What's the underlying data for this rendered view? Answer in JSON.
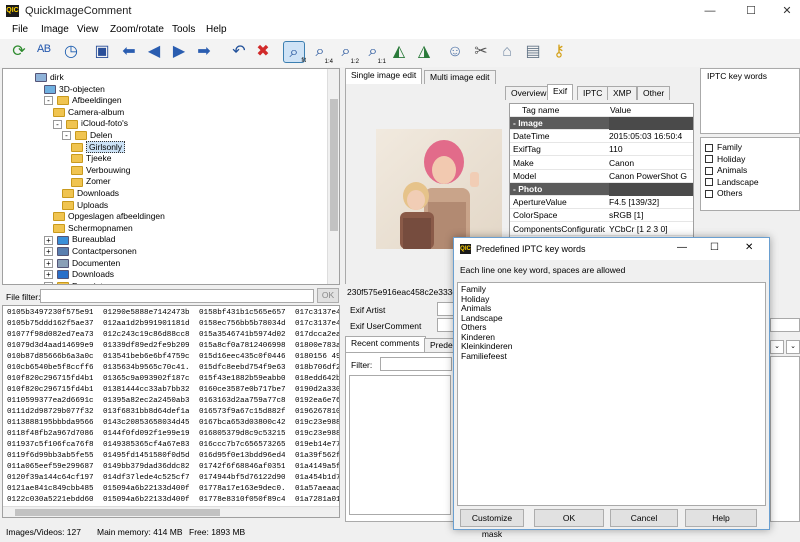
{
  "window": {
    "title": "QuickImageComment",
    "app_icon": "QIC",
    "minimize": "—",
    "maximize": "☐",
    "close": "✕"
  },
  "menu": [
    "File",
    "Image",
    "View",
    "Zoom/rotate",
    "Tools",
    "Help"
  ],
  "toolbar": [
    {
      "icon": "refresh-icon",
      "glyph": "⟳",
      "color": "#2e8b2e"
    },
    {
      "icon": "spellcheck-icon",
      "glyph": "ᴬᴮ",
      "color": "#2a5db0"
    },
    {
      "icon": "clock-icon",
      "glyph": "◷",
      "color": "#1f5fb0"
    },
    {
      "icon": "save-icon",
      "glyph": "▣",
      "color": "#2a4f99"
    },
    {
      "icon": "arrow-left-icon",
      "glyph": "⬅",
      "color": "#2a5db0"
    },
    {
      "icon": "circle-left-icon",
      "glyph": "◀",
      "color": "#2a5db0"
    },
    {
      "icon": "circle-right-icon",
      "glyph": "▶",
      "color": "#2a5db0"
    },
    {
      "icon": "arrow-right-icon",
      "glyph": "➡",
      "color": "#2a5db0"
    },
    {
      "icon": "undo-icon",
      "glyph": "↶",
      "color": "#1f4f99"
    },
    {
      "icon": "delete-icon",
      "glyph": "✖",
      "color": "#d12a2a"
    },
    {
      "icon": "zoom-fit-icon",
      "glyph": "⌕",
      "color": "#1f4f99",
      "sub": "fit",
      "selected": true
    },
    {
      "icon": "zoom-1-4-icon",
      "glyph": "⌕",
      "color": "#1f4f99",
      "sub": "1:4"
    },
    {
      "icon": "zoom-1-2-icon",
      "glyph": "⌕",
      "color": "#1f4f99",
      "sub": "1:2"
    },
    {
      "icon": "zoom-1-1-icon",
      "glyph": "⌕",
      "color": "#1f4f99",
      "sub": "1:1"
    },
    {
      "icon": "rotate-left-icon",
      "glyph": "◭",
      "color": "#2a7a3a"
    },
    {
      "icon": "rotate-right-icon",
      "glyph": "◮",
      "color": "#2a7a3a"
    },
    {
      "icon": "users-icon",
      "glyph": "☺",
      "color": "#4a6fa5"
    },
    {
      "icon": "tools-icon",
      "glyph": "✂",
      "color": "#555555"
    },
    {
      "icon": "tag-icon",
      "glyph": "⌂",
      "color": "#7a8fa8"
    },
    {
      "icon": "document-icon",
      "glyph": "▤",
      "color": "#667788"
    },
    {
      "icon": "key-icon",
      "glyph": "⚷",
      "color": "#d4a017"
    }
  ],
  "tree": [
    {
      "indent": 2,
      "exp": "",
      "kind": "user",
      "label": "dirk"
    },
    {
      "indent": 3,
      "exp": "",
      "kind": "cube",
      "label": "3D-objecten"
    },
    {
      "indent": 3,
      "exp": "-",
      "kind": "folder",
      "label": "Afbeeldingen"
    },
    {
      "indent": 4,
      "exp": "",
      "kind": "folder",
      "label": "Camera-album"
    },
    {
      "indent": 4,
      "exp": "-",
      "kind": "folder",
      "label": "iCloud-foto's"
    },
    {
      "indent": 5,
      "exp": "-",
      "kind": "folder",
      "label": "Delen"
    },
    {
      "indent": 6,
      "exp": "",
      "kind": "folder",
      "label": "Girlsonly",
      "selected": true
    },
    {
      "indent": 6,
      "exp": "",
      "kind": "folder",
      "label": "Tjeeke"
    },
    {
      "indent": 6,
      "exp": "",
      "kind": "folder",
      "label": "Verbouwing"
    },
    {
      "indent": 6,
      "exp": "",
      "kind": "folder",
      "label": "Zomer"
    },
    {
      "indent": 5,
      "exp": "",
      "kind": "folder",
      "label": "Downloads"
    },
    {
      "indent": 5,
      "exp": "",
      "kind": "folder",
      "label": "Uploads"
    },
    {
      "indent": 4,
      "exp": "",
      "kind": "folder",
      "label": "Opgeslagen afbeeldingen"
    },
    {
      "indent": 4,
      "exp": "",
      "kind": "folder",
      "label": "Schermopnamen"
    },
    {
      "indent": 3,
      "exp": "+",
      "kind": "desktop",
      "label": "Bureaublad"
    },
    {
      "indent": 3,
      "exp": "+",
      "kind": "contacts",
      "label": "Contactpersonen"
    },
    {
      "indent": 3,
      "exp": "+",
      "kind": "docs",
      "label": "Documenten"
    },
    {
      "indent": 3,
      "exp": "+",
      "kind": "download",
      "label": "Downloads"
    },
    {
      "indent": 3,
      "exp": "+",
      "kind": "folder",
      "label": "Favorieten"
    }
  ],
  "file_filter": {
    "label": "File filter:",
    "value": "",
    "ok": "OK"
  },
  "files": [
    [
      "0105b3497230f575e916...",
      "01290e5888e7142473b...",
      "0158bf431b1c565e6576...",
      "017c3137e45"
    ],
    [
      "0105b75ddd162f5ae373...",
      "012aa1d2b991901181d...",
      "0158ec756bb5b78034d...",
      "017c3137e45"
    ],
    [
      "01077f98d082ed7ea73...",
      "012c243c19c86d88cc8...",
      "015a3546741b5974d02...",
      "017dcca2ea7"
    ],
    [
      "01079d3d4aad14699e9...",
      "01339df89ed2fe9b209a...",
      "015a8cf0a7812406998...",
      "01800e783a2"
    ],
    [
      "010b87d85666b6a3a0c...",
      "013541beb6e6bf4759c...",
      "015d16eec435c0f04463...",
      "0180156 49a6"
    ],
    [
      "010cb6540be5f8ccff64c...",
      "0135634b9565c70c41...",
      "015dfc8eebd754f9e632...",
      "018b706df22"
    ],
    [
      "010f820c296715fd4b12...",
      "01365c9a093902f187ce...",
      "015f43e1882b59eabb0d...",
      "018edd642b"
    ],
    [
      "010f820c296715fd4b12...",
      "01381444cc33ab7bb32...",
      "0160ce3587e0b717be7...",
      "0190d2a330a"
    ],
    [
      "0110599377ea2d6691c6...",
      "01395a82ec2a2450ab3...",
      "0163163d2aa759a77c8...",
      "0192ea6e76d"
    ],
    [
      "0111d2d98729b077f326...",
      "013f6831bb8d64def1a3...",
      "016573f9a67c15d882f4...",
      "01962678103"
    ],
    [
      "0113888195bbbda9566...",
      "0143c20853658034d45...",
      "0167bca653d03800c42...",
      "019c23e988e"
    ],
    [
      "0118f48fb2a967d7086...",
      "0144f0fd092f1e99e1972...",
      "016805379d8c9c53215f...",
      "019c23e988e"
    ],
    [
      "011937c5f106fca76f86...",
      "0149385365cf4a67e83d...",
      "016ccc7b7c656573265...",
      "019eb14e775"
    ],
    [
      "0119f6d99bb3ab5fe551...",
      "01495fd1451580f0d5d...",
      "016d95f0e13bdd96ed4d...",
      "01a39f562f4"
    ],
    [
      "011a065eef59e2996879...",
      "0149bb379dad36ddc82...",
      "01742f6f68846af03512...",
      "01a4149a5f3"
    ],
    [
      "0120f39a144c64cf197b...",
      "014df37lede4c525cf7e...",
      "0174944bf5d76122d90c...",
      "01a454b1d7d"
    ],
    [
      "0121ae841c849cbb485...",
      "015094a6b22133d400f3...",
      "01778a17e163e9dec0...",
      "01a57aeaadc"
    ],
    [
      "0122c030a5221ebdd60...",
      "015094a6b22133d400f3...",
      "01778e8310f050f89c41...",
      "01a7281a014"
    ],
    [
      "01258e65aa42270ceb5...",
      "01526601d63c40d02a5...",
      "017ac646cf2426a8e975...",
      "01a7ef9e62e"
    ]
  ],
  "center": {
    "tabs": [
      "Single image edit",
      "Multi image edit"
    ],
    "filename": "230f575e916eac458c2e333c5",
    "artist_label": "Exif Artist",
    "usercomment_label": "Exif UserComment",
    "bottom_tabs": [
      "Recent comments",
      "Prede"
    ],
    "filter_label": "Filter:"
  },
  "meta": {
    "tabs": [
      "Overview",
      "Exif",
      "IPTC",
      "XMP",
      "Other"
    ],
    "columns": [
      "Tag name",
      "Value"
    ],
    "rows": [
      {
        "section": true,
        "tag": "- Image",
        "value": ""
      },
      {
        "tag": "DateTime",
        "value": "2015:05:03 16:50:4"
      },
      {
        "tag": "ExifTag",
        "value": "110"
      },
      {
        "tag": "Make",
        "value": "Canon"
      },
      {
        "tag": "Model",
        "value": "Canon PowerShot G"
      },
      {
        "section": true,
        "tag": "- Photo",
        "value": ""
      },
      {
        "tag": "ApertureValue",
        "value": "F4.5   [139/32]"
      },
      {
        "tag": "ColorSpace",
        "value": "sRGB   [1]"
      },
      {
        "tag": "ComponentsConfiguration",
        "value": "YCbCr   [1 2 3 0]"
      }
    ]
  },
  "iptc": {
    "header": "IPTC key words",
    "items": [
      "Family",
      "Holiday",
      "Animals",
      "Landscape",
      "Others"
    ]
  },
  "dialog": {
    "title": "Predefined IPTC key words",
    "hint": "Each line one key word, spaces are allowed",
    "lines": [
      "Family",
      "Holiday",
      "Animals",
      "Landscape",
      "Others",
      "Kinderen",
      "Kleinkinderen",
      "Familiefeest"
    ],
    "buttons": {
      "customize": "Customize mask",
      "ok": "OK",
      "cancel": "Cancel",
      "help": "Help"
    },
    "minimize": "—",
    "maximize": "☐",
    "close": "✕"
  },
  "status": {
    "images": "Images/Videos: 127",
    "memory": "Main memory: 414 MB",
    "free": "Free: 1893 MB"
  }
}
